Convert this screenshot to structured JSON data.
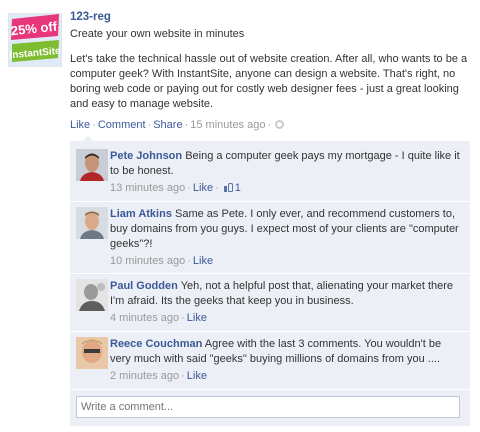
{
  "post": {
    "poster": "123-reg",
    "avatar_text_top": "25% off",
    "avatar_text_bottom": "InstantSite",
    "title": "Create your own website in minutes",
    "body": "Let's take the technical hassle out of website creation. After all, who wants to be a computer geek? With InstantSite, anyone can design a website. That's right, no boring web code or paying out for costly web designer fees - just a great looking and easy to manage website.",
    "actions": {
      "like": "Like",
      "comment": "Comment",
      "share": "Share"
    },
    "time": "15 minutes ago",
    "separator": "·"
  },
  "comments": [
    {
      "name": "Pete Johnson",
      "text": "Being a computer geek pays my mortgage - I quite like it to be honest.",
      "time": "13 minutes ago",
      "like": "Like",
      "likes": "1"
    },
    {
      "name": "Liam Atkins",
      "text": "Same as Pete. I only ever, and recommend customers to, buy domains from you guys. I expect most of your clients are \"computer geeks\"?!",
      "time": "10 minutes ago",
      "like": "Like"
    },
    {
      "name": "Paul Godden",
      "text": "Yeh, not a helpful post that, alienating your market there I'm afraid. Its the geeks that keep you in business.",
      "time": "4 minutes ago",
      "like": "Like"
    },
    {
      "name": "Reece Couchman",
      "text": "Agree with the last 3 comments. You wouldn't be very much with said \"geeks\" buying millions of domains from you ....",
      "time": "2 minutes ago",
      "like": "Like"
    }
  ],
  "write_comment": {
    "placeholder": "Write a comment..."
  },
  "colors": {
    "link": "#3b5998",
    "comment_bg": "#eceff5",
    "badge_bg": "#e8367b",
    "badge_fg": "#ffffff",
    "badge_green": "#7dbd2f"
  },
  "icons": {
    "privacy": "globe-icon",
    "like_count": "thumbs-up-icon"
  }
}
